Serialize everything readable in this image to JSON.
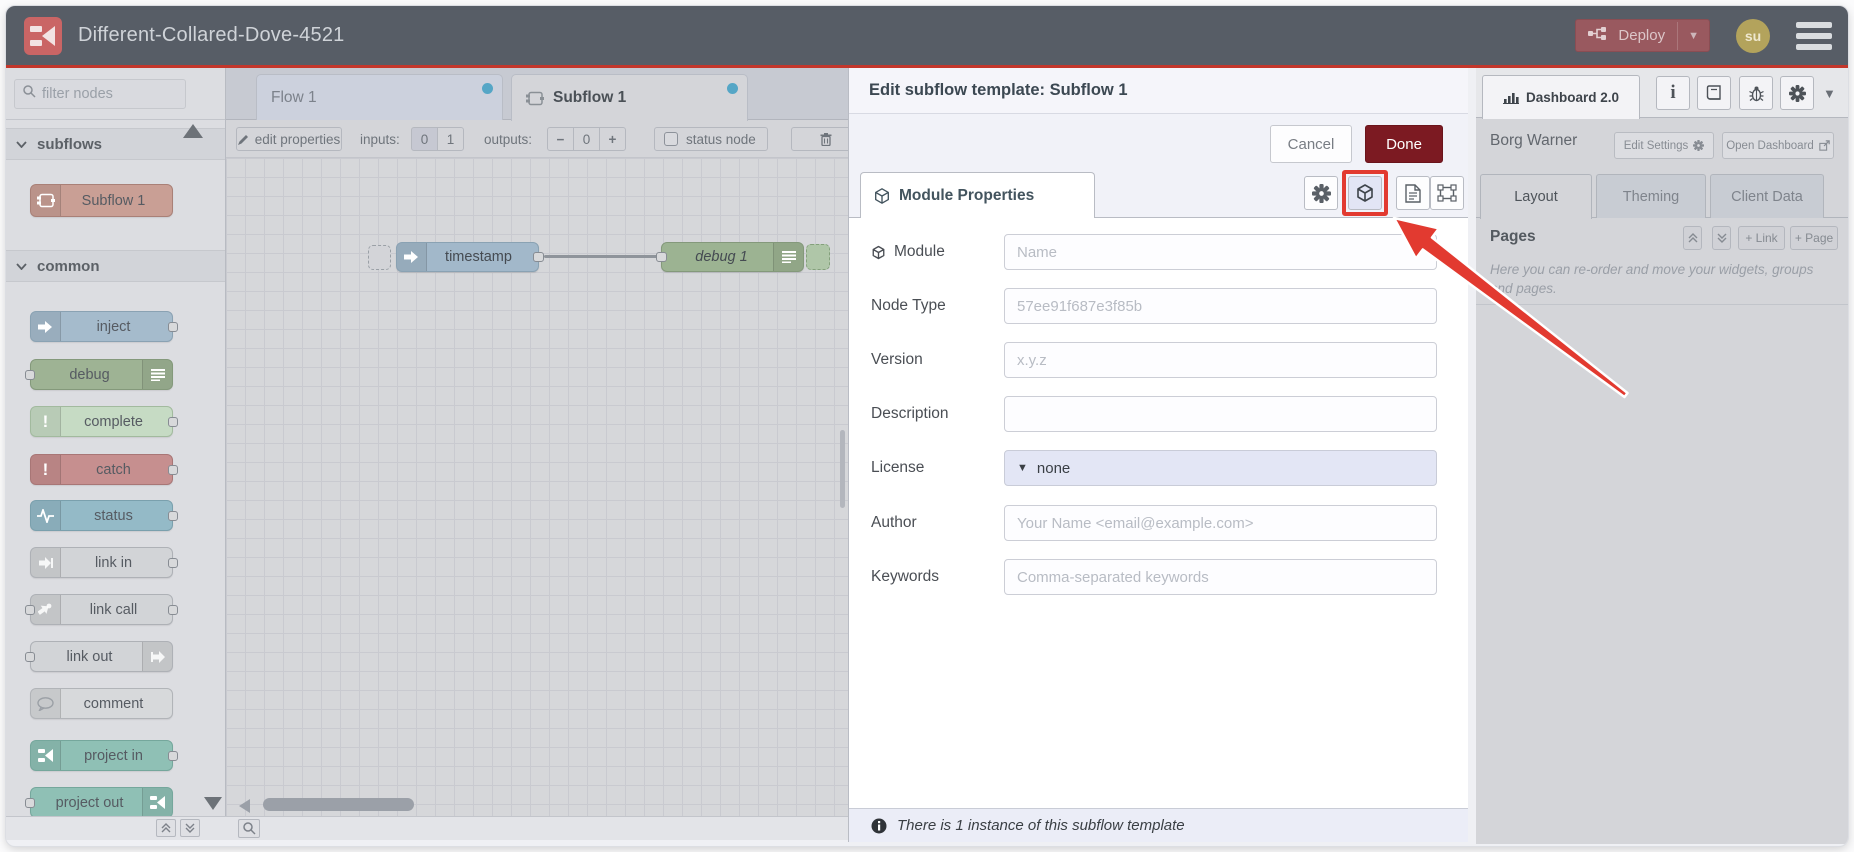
{
  "app": {
    "title": "Different-Collared-Dove-4521"
  },
  "header": {
    "deploy": "Deploy",
    "avatar": "su"
  },
  "palette": {
    "filter_placeholder": "filter nodes",
    "sections": [
      {
        "label": "subflows"
      },
      {
        "label": "common"
      }
    ],
    "nodes": {
      "subflow": "Subflow 1",
      "inject": "inject",
      "debug": "debug",
      "complete": "complete",
      "catch": "catch",
      "status": "status",
      "link_in": "link in",
      "link_call": "link call",
      "link_out": "link out",
      "comment": "comment",
      "project_in": "project in",
      "project_out": "project out"
    }
  },
  "workspace": {
    "tabs": [
      {
        "label": "Flow 1"
      },
      {
        "label": "Subflow 1"
      }
    ],
    "toolbar": {
      "edit_properties": "edit properties",
      "inputs_label": "inputs:",
      "inputs": [
        "0",
        "1"
      ],
      "outputs_label": "outputs:",
      "outputs_minus": "−",
      "outputs_value": "0",
      "outputs_plus": "+",
      "status_node": "status node"
    },
    "nodes": {
      "timestamp": "timestamp",
      "debug1": "debug 1"
    }
  },
  "dialog": {
    "title": "Edit subflow template: Subflow 1",
    "cancel": "Cancel",
    "done": "Done",
    "tab": "Module Properties",
    "fields": {
      "module": {
        "label": "Module",
        "placeholder": "Name"
      },
      "node_type": {
        "label": "Node Type",
        "placeholder": "57ee91f687e3f85b"
      },
      "version": {
        "label": "Version",
        "placeholder": "x.y.z"
      },
      "description": {
        "label": "Description",
        "placeholder": ""
      },
      "license": {
        "label": "License",
        "value": "none"
      },
      "author": {
        "label": "Author",
        "placeholder": "Your Name <email@example.com>"
      },
      "keywords": {
        "label": "Keywords",
        "placeholder": "Comma-separated keywords"
      }
    },
    "footer_note": "There is 1 instance of this subflow template"
  },
  "sidebar": {
    "tab": "Dashboard 2.0",
    "owner": "Borg Warner",
    "edit_settings": "Edit Settings",
    "open_dashboard": "Open Dashboard",
    "tabs": [
      "Layout",
      "Theming",
      "Client Data"
    ],
    "pages": "Pages",
    "add_link": "+ Link",
    "add_page": "+ Page",
    "help": "Here you can re-order and move your widgets, groups and pages."
  },
  "colors": {
    "accent_red": "#c3362b",
    "deploy_bg": "#99595f",
    "done_bg": "#7c1a22",
    "annotation": "#e23a30",
    "blue_dot": "#55a6c6"
  }
}
